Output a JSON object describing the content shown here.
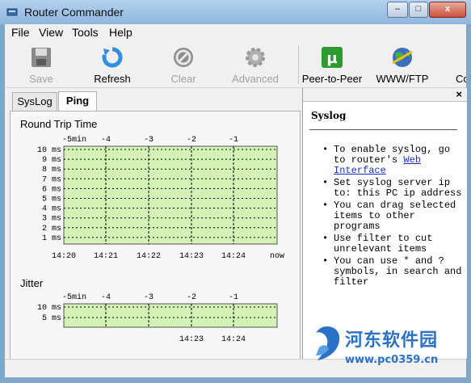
{
  "window": {
    "title": "Router Commander",
    "minimize_glyph": "–",
    "maximize_glyph": "□",
    "close_glyph": "x"
  },
  "menu": [
    "File",
    "View",
    "Tools",
    "Help"
  ],
  "toolbar": {
    "save": "Save",
    "refresh": "Refresh",
    "clear": "Clear",
    "advanced": "Advanced",
    "peer": "Peer-to-Peer",
    "www": "WWW/FTP",
    "cut": "Co"
  },
  "tabs": [
    "SysLog",
    "Ping"
  ],
  "rtt": {
    "title": "Round Trip Time",
    "top_labels": [
      "-5min",
      "-4",
      "-3",
      "-2",
      "-1"
    ],
    "y_labels": [
      "10 ms",
      "9 ms",
      "8 ms",
      "7 ms",
      "6 ms",
      "5 ms",
      "4 ms",
      "3 ms",
      "2 ms",
      "1 ms"
    ],
    "x_labels": [
      "14:20",
      "14:21",
      "14:22",
      "14:23",
      "14:24",
      "now"
    ]
  },
  "jitter": {
    "title": "Jitter",
    "top_labels": [
      "-5min",
      "-4",
      "-3",
      "-2",
      "-1"
    ],
    "y_labels": [
      "10 ms",
      "5 ms"
    ],
    "x_labels": [
      "14:23",
      "14:24"
    ]
  },
  "syslog_panel": {
    "close": "×",
    "title": "Syslog",
    "items": [
      {
        "text": "To enable syslog, go to router's ",
        "link": "Web Interface"
      },
      {
        "text": "Set syslog server ip to: this PC ip address"
      },
      {
        "text": "You can drag selected items to other programs"
      },
      {
        "text": "Use filter to cut unrelevant items"
      },
      {
        "text": "You can use * and ? symbols, in search and filter"
      }
    ]
  },
  "watermark": {
    "name": "河东软件园",
    "url": "www.pc0359.cn"
  },
  "colors": {
    "chart_bg": "#d5f2b6",
    "link": "#1a32c8",
    "watermark": "#2a72c8"
  }
}
